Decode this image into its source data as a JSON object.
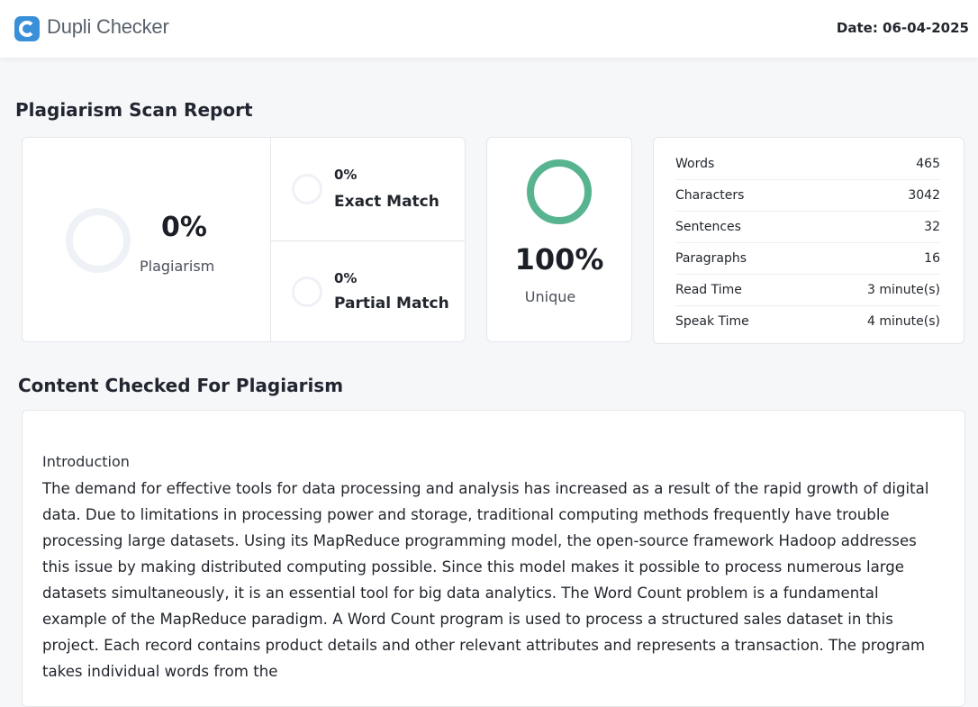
{
  "header": {
    "brand_name": "Dupli Checker",
    "logo_icon": "dupli-checker-logo-icon",
    "brand_color": "#3a8fd9",
    "date_text": "Date: 06-04-2025"
  },
  "report": {
    "title": "Plagiarism Scan Report",
    "plagiarism_percent": "0%",
    "plagiarism_label": "Plagiarism",
    "exact_match_percent": "0%",
    "exact_match_label": "Exact Match",
    "partial_match_percent": "0%",
    "partial_match_label": "Partial Match",
    "unique_percent": "100%",
    "unique_label": "Unique",
    "unique_color": "#58b48f"
  },
  "stats": [
    {
      "label": "Words",
      "value": "465"
    },
    {
      "label": "Characters",
      "value": "3042"
    },
    {
      "label": "Sentences",
      "value": "32"
    },
    {
      "label": "Paragraphs",
      "value": "16"
    },
    {
      "label": "Read Time",
      "value": "3 minute(s)"
    },
    {
      "label": "Speak Time",
      "value": "4 minute(s)"
    }
  ],
  "content": {
    "title": "Content Checked For Plagiarism",
    "intro_heading": "Introduction",
    "body": " The demand for effective tools for data processing and analysis has increased as a result of the rapid growth of digital data. Due to limitations in processing power and storage, traditional computing methods frequently have trouble processing large datasets. Using its MapReduce programming model, the open-source framework Hadoop addresses this issue by making distributed computing possible. Since this model makes it possible to process numerous large datasets simultaneously, it is an essential tool for big data analytics. The Word Count problem is a fundamental example of the MapReduce paradigm.  A Word Count program is used to process a structured sales dataset in this project. Each record contains product details and other relevant attributes and represents a transaction. The program takes individual words from the"
  }
}
